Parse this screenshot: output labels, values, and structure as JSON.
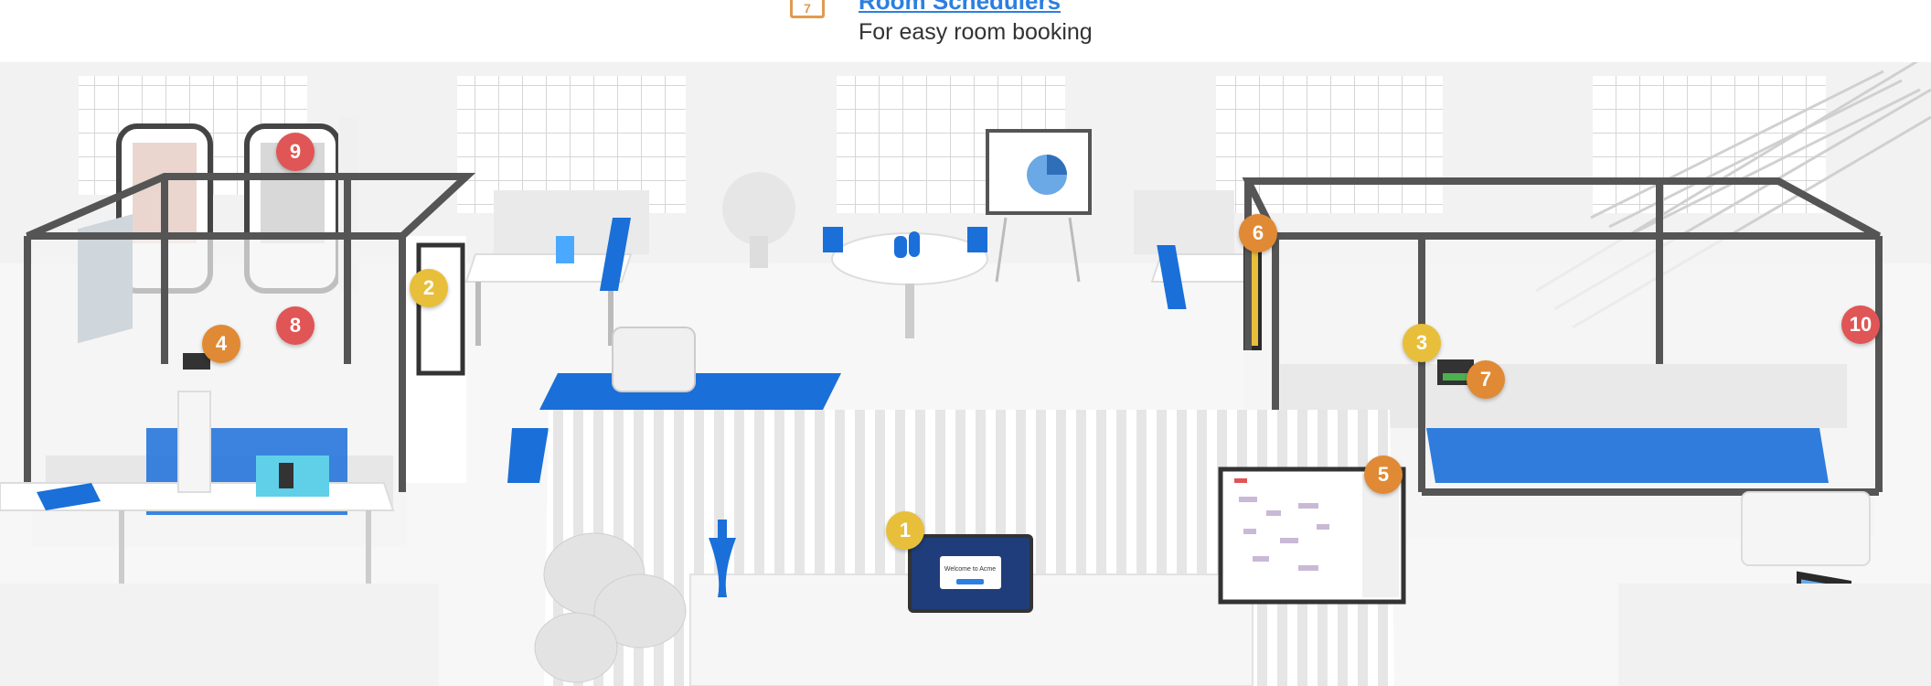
{
  "legend": {
    "number": "7",
    "title": "Room  Schedulers",
    "description": "For easy room booking"
  },
  "colors": {
    "yellow": "#e8bf3a",
    "orange": "#e08a35",
    "red": "#e05555",
    "blue": "#1a6fd9",
    "link": "#2d7fe0"
  },
  "hotspots": [
    {
      "label": "1",
      "color": "yellow"
    },
    {
      "label": "2",
      "color": "yellow"
    },
    {
      "label": "3",
      "color": "yellow"
    },
    {
      "label": "4",
      "color": "orange"
    },
    {
      "label": "5",
      "color": "orange"
    },
    {
      "label": "6",
      "color": "orange"
    },
    {
      "label": "7",
      "color": "orange"
    },
    {
      "label": "8",
      "color": "red"
    },
    {
      "label": "9",
      "color": "red"
    },
    {
      "label": "10",
      "color": "red"
    }
  ],
  "screens": {
    "reception_welcome": "Welcome to Acme"
  }
}
